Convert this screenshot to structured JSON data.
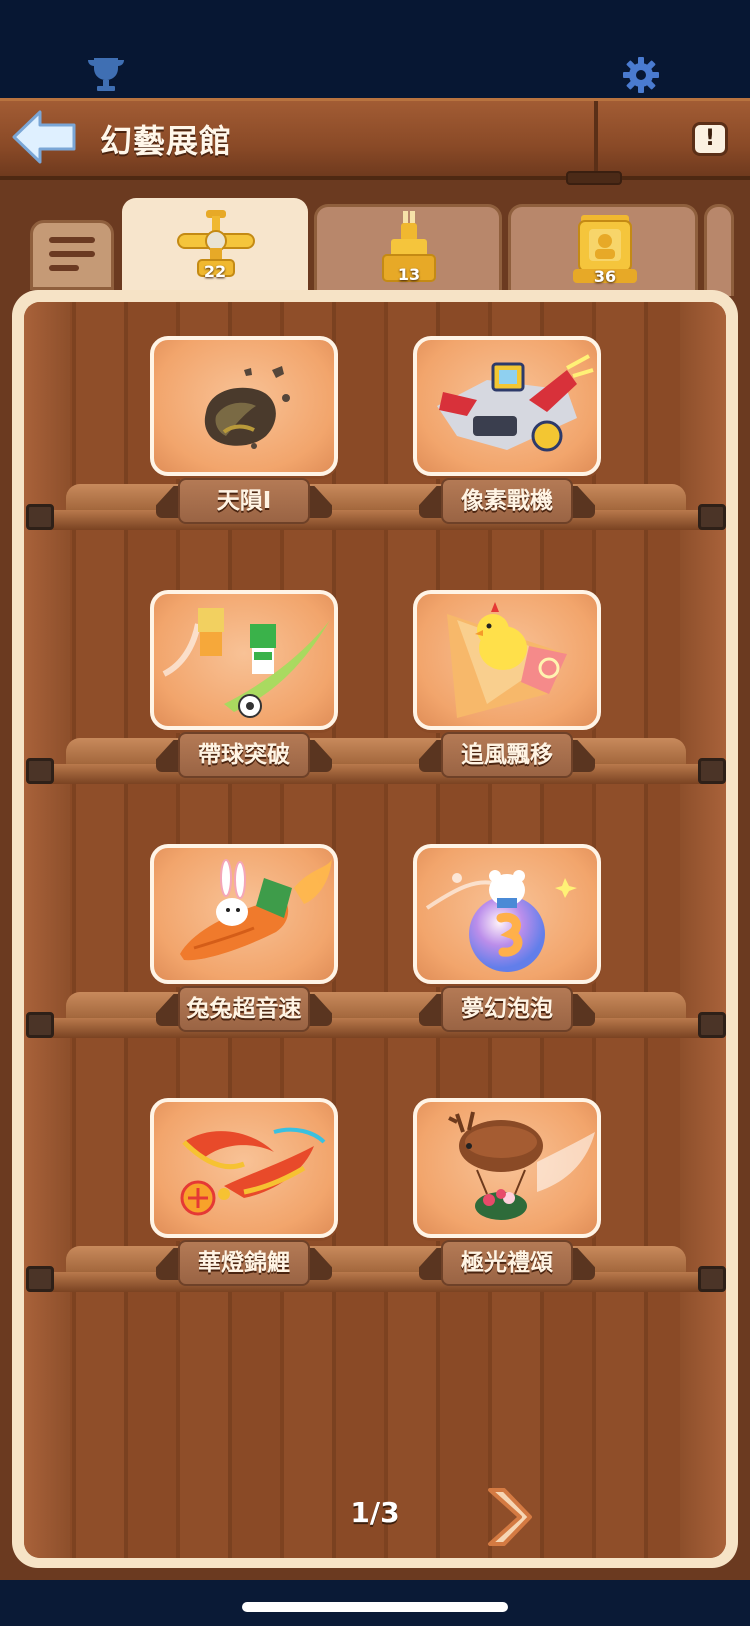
{
  "header": {
    "title": "幻藝展館"
  },
  "tabs": [
    {
      "icon": "plane-trophy-icon",
      "count": "22",
      "active": true
    },
    {
      "icon": "castle-trophy-icon",
      "count": "13",
      "active": false
    },
    {
      "icon": "frame-trophy-icon",
      "count": "36",
      "active": false
    }
  ],
  "shelves": [
    {
      "items": [
        {
          "name": "天隕Ⅰ",
          "icon": "meteor-rock-icon"
        },
        {
          "name": "像素戰機",
          "icon": "pixel-jet-icon"
        }
      ]
    },
    {
      "items": [
        {
          "name": "帶球突破",
          "icon": "soccer-dash-icon"
        },
        {
          "name": "追風飄移",
          "icon": "chick-kite-icon"
        }
      ]
    },
    {
      "items": [
        {
          "name": "兔兔超音速",
          "icon": "bunny-carrot-rocket-icon"
        },
        {
          "name": "夢幻泡泡",
          "icon": "bubble-bear-icon"
        }
      ]
    },
    {
      "items": [
        {
          "name": "華燈錦鯉",
          "icon": "lantern-koi-icon"
        },
        {
          "name": "極光禮頌",
          "icon": "reindeer-balloon-icon"
        }
      ]
    }
  ],
  "pager": {
    "label": "1/3"
  },
  "colors": {
    "wood": "#8a4a26",
    "card": "#f2a56c",
    "cream": "#f6e3c6",
    "topbar": "#071733"
  }
}
